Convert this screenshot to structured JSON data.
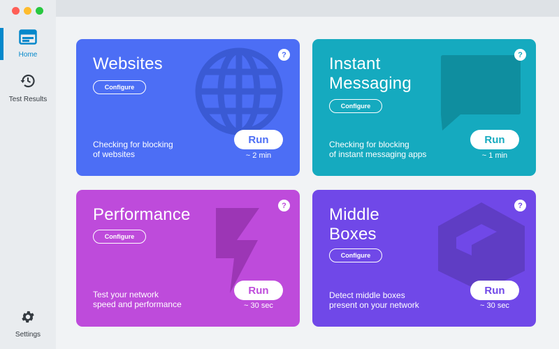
{
  "colors": {
    "websites": "#4c6ef5",
    "instant_messaging": "#15aabf",
    "performance": "#be4bdb",
    "middle_boxes": "#7048e8",
    "nav_active": "#0588cb"
  },
  "sidebar": {
    "items": [
      {
        "label": "Home",
        "icon": "home-icon",
        "active": true
      },
      {
        "label": "Test Results",
        "icon": "history-icon",
        "active": false
      },
      {
        "label": "Settings",
        "icon": "gear-icon",
        "active": false
      }
    ]
  },
  "cards": {
    "websites": {
      "title_lines": [
        "Websites"
      ],
      "configure_label": "Configure",
      "description_lines": [
        "Checking for blocking",
        "of websites"
      ],
      "run_label": "Run",
      "duration": "~ 2 min",
      "help": "?",
      "icon": "globe-icon"
    },
    "instant_messaging": {
      "title_lines": [
        "Instant",
        "Messaging"
      ],
      "configure_label": "Configure",
      "description_lines": [
        "Checking for blocking",
        "of instant messaging apps"
      ],
      "run_label": "Run",
      "duration": "~ 1 min",
      "help": "?",
      "icon": "chat-bubble-icon"
    },
    "performance": {
      "title_lines": [
        "Performance"
      ],
      "configure_label": "Configure",
      "description_lines": [
        "Test your network",
        "speed and performance"
      ],
      "run_label": "Run",
      "duration": "~ 30 sec",
      "help": "?",
      "icon": "lightning-bolt-icon"
    },
    "middle_boxes": {
      "title_lines": [
        "Middle",
        "Boxes"
      ],
      "configure_label": "Configure",
      "description_lines": [
        "Detect middle boxes",
        "present on your network"
      ],
      "run_label": "Run",
      "duration": "~ 30 sec",
      "help": "?",
      "icon": "box-icon"
    }
  }
}
